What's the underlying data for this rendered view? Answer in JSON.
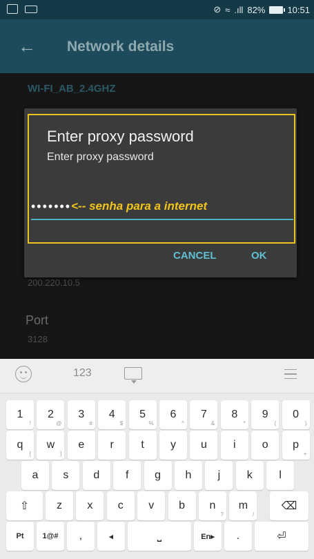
{
  "status_bar": {
    "battery": "82%",
    "time": "10:51",
    "signal": ".ıll",
    "wifi_icon": "wifi-icon",
    "sync_icon": "sync-icon"
  },
  "toolbar": {
    "title": "Network details",
    "back_icon": "arrow-left-icon"
  },
  "background": {
    "ssid": "WI-FI_AB_2.4GHZ",
    "ip_value": "200.220.10.5",
    "port_label": "Port",
    "port_value": "3128"
  },
  "dialog": {
    "title": "Enter proxy password",
    "message": "Enter proxy password",
    "password_masked": "•••••••",
    "annotation": "<-- senha para a internet",
    "cancel_label": "CANCEL",
    "ok_label": "OK",
    "highlight_color": "#e8c41c",
    "accent_color": "#5fc0d3"
  },
  "keyboard": {
    "toolbar": {
      "mode_label": "123"
    },
    "rows": [
      [
        {
          "k": "1",
          "s": "!"
        },
        {
          "k": "2",
          "s": "@"
        },
        {
          "k": "3",
          "s": "#"
        },
        {
          "k": "4",
          "s": "$"
        },
        {
          "k": "5",
          "s": "%"
        },
        {
          "k": "6",
          "s": "^"
        },
        {
          "k": "7",
          "s": "&"
        },
        {
          "k": "8",
          "s": "*"
        },
        {
          "k": "9",
          "s": "("
        },
        {
          "k": "0",
          "s": ")"
        }
      ],
      [
        {
          "k": "q",
          "s": "["
        },
        {
          "k": "w",
          "s": "]"
        },
        {
          "k": "e",
          "s": ""
        },
        {
          "k": "r",
          "s": ""
        },
        {
          "k": "t",
          "s": ""
        },
        {
          "k": "y",
          "s": ""
        },
        {
          "k": "u",
          "s": ""
        },
        {
          "k": "i",
          "s": ""
        },
        {
          "k": "o",
          "s": ""
        },
        {
          "k": "p",
          "s": "+"
        }
      ],
      [
        {
          "k": "a",
          "s": ""
        },
        {
          "k": "s",
          "s": ""
        },
        {
          "k": "d",
          "s": ""
        },
        {
          "k": "f",
          "s": ""
        },
        {
          "k": "g",
          "s": ""
        },
        {
          "k": "h",
          "s": ""
        },
        {
          "k": "j",
          "s": ""
        },
        {
          "k": "k",
          "s": ""
        },
        {
          "k": "l",
          "s": ""
        }
      ],
      [
        {
          "k": "z",
          "s": ""
        },
        {
          "k": "x",
          "s": ""
        },
        {
          "k": "c",
          "s": ""
        },
        {
          "k": "v",
          "s": ""
        },
        {
          "k": "b",
          "s": ""
        },
        {
          "k": "n",
          "s": "?"
        },
        {
          "k": "m",
          "s": "/"
        }
      ]
    ],
    "bottom": {
      "pt": "Pt",
      "sym": "1@#",
      "comma": ",",
      "lang_left": "◂",
      "lang": "En▸",
      "period": "."
    }
  }
}
